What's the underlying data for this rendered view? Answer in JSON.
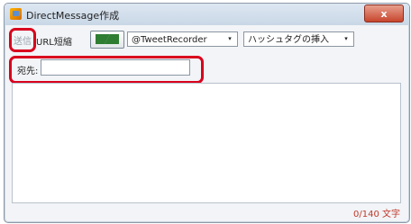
{
  "window": {
    "title": "DirectMessage作成",
    "close_glyph": "x"
  },
  "toolbar": {
    "send_label": "送信",
    "url_shorten_label": "URL短縮",
    "url_icon": "url-shorten-icon",
    "account_select": {
      "value": "@TweetRecorder",
      "arrow": "▾"
    },
    "hashtag_select": {
      "value": "ハッシュタグの挿入",
      "arrow": "▾"
    }
  },
  "destination": {
    "label": "宛先:",
    "value": ""
  },
  "message_body": {
    "value": ""
  },
  "scrollbar": {
    "up": "▲",
    "down": "▼"
  },
  "status": {
    "char_count": "0/140 文字"
  },
  "colors": {
    "highlight": "#d9001e",
    "counter": "#c0392b"
  }
}
